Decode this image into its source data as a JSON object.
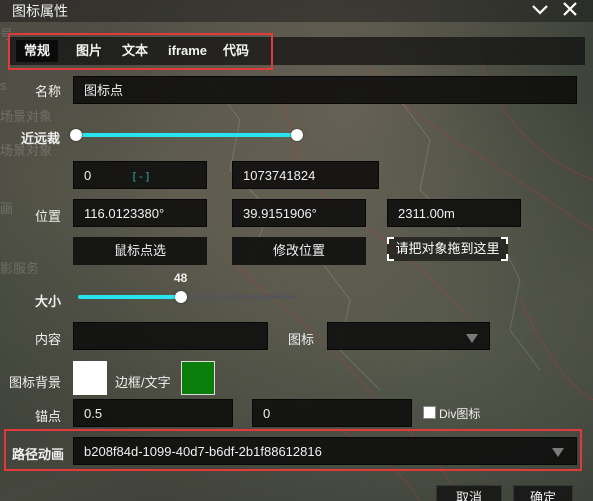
{
  "window": {
    "title": "图标属性"
  },
  "background_ghost_text": [
    "号",
    "s",
    "场景对象",
    "场景对象",
    "画",
    "影服务"
  ],
  "tabs": [
    {
      "label": "常规",
      "active": true
    },
    {
      "label": "图片",
      "active": false
    },
    {
      "label": "文本",
      "active": false
    },
    {
      "label": "iframe",
      "active": false
    },
    {
      "label": "代码",
      "active": false
    }
  ],
  "form": {
    "name_label": "名称",
    "name_value": "图标点",
    "near_far_label": "近远裁",
    "near_value": "0",
    "far_value": "1073741824",
    "position_label": "位置",
    "longitude": "116.0123380°",
    "latitude": "39.9151906°",
    "height": "2311.00m",
    "mouse_pick_button": "鼠标点选",
    "modify_position_button": "修改位置",
    "drop_target_hint": "请把对象拖到这里",
    "size_label": "大小",
    "size_value": "48",
    "size_slider_fraction": 0.47,
    "content_label": "内容",
    "content_value": "",
    "icon_label": "图标",
    "icon_value": "",
    "icon_background_label": "图标背景",
    "border_text_label": "边框/文字",
    "icon_background_color": "#ffffff",
    "border_text_color": "#0a7d0a",
    "anchor_label": "锚点",
    "anchor_x": "0.5",
    "anchor_y": "0",
    "div_icon_label": "Div图标",
    "div_icon_checked": false,
    "path_animation_label": "路径动画",
    "path_animation_value": "b208f84d-1099-40d7-b6df-2b1f88612816"
  },
  "footer": {
    "cancel_label": "取消",
    "confirm_label": "确定"
  },
  "colors": {
    "accent": "#27e4f0",
    "highlight_box": "#e03a3a"
  }
}
